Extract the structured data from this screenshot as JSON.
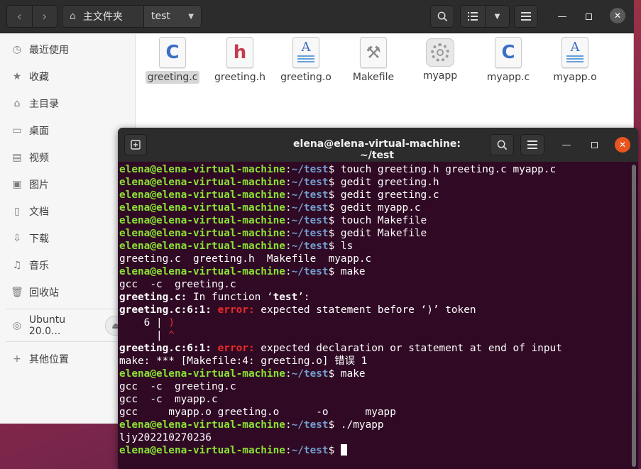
{
  "file_manager": {
    "path": {
      "home_label": "主文件夹",
      "current": "test"
    },
    "sidebar": {
      "items": [
        {
          "icon": "clock-icon",
          "label": "最近使用"
        },
        {
          "icon": "star-icon",
          "label": "收藏"
        },
        {
          "icon": "home-icon",
          "label": "主目录"
        },
        {
          "icon": "desktop-icon",
          "label": "桌面"
        },
        {
          "icon": "video-icon",
          "label": "视频"
        },
        {
          "icon": "picture-icon",
          "label": "图片"
        },
        {
          "icon": "document-icon",
          "label": "文档"
        },
        {
          "icon": "download-icon",
          "label": "下载"
        },
        {
          "icon": "music-icon",
          "label": "音乐"
        },
        {
          "icon": "trash-icon",
          "label": "回收站"
        }
      ],
      "devices": [
        {
          "icon": "disc-icon",
          "label": "Ubuntu 20.0..."
        }
      ],
      "other": {
        "icon": "plus-icon",
        "label": "其他位置"
      }
    },
    "files": [
      {
        "name": "greeting.c",
        "kind": "c-source",
        "selected": true
      },
      {
        "name": "greeting.h",
        "kind": "c-header",
        "selected": false
      },
      {
        "name": "greeting.o",
        "kind": "text",
        "selected": false
      },
      {
        "name": "Makefile",
        "kind": "makefile",
        "selected": false
      },
      {
        "name": "myapp",
        "kind": "executable",
        "selected": false
      },
      {
        "name": "myapp.c",
        "kind": "c-source",
        "selected": false
      },
      {
        "name": "myapp.o",
        "kind": "text",
        "selected": false
      }
    ]
  },
  "terminal": {
    "title": "elena@elena-virtual-machine: ~/test",
    "prompt": {
      "user": "elena@elena-virtual-machine",
      "sep": ":",
      "path": "~/test",
      "dollar": "$ "
    },
    "lines": [
      {
        "type": "prompt",
        "cmd": "touch greeting.h greeting.c myapp.c"
      },
      {
        "type": "prompt",
        "cmd": "gedit greeting.h"
      },
      {
        "type": "prompt",
        "cmd": "gedit greeting.c"
      },
      {
        "type": "prompt",
        "cmd": "gedit myapp.c"
      },
      {
        "type": "prompt",
        "cmd": "touch Makefile"
      },
      {
        "type": "prompt",
        "cmd": "gedit Makefile"
      },
      {
        "type": "prompt",
        "cmd": "ls"
      },
      {
        "type": "out",
        "text": "greeting.c  greeting.h  Makefile  myapp.c"
      },
      {
        "type": "prompt",
        "cmd": "make"
      },
      {
        "type": "out",
        "text": "gcc  -c  greeting.c"
      },
      {
        "type": "infn",
        "file": "greeting.c:",
        "text": " In function ‘",
        "fn": "test",
        "end": "’:"
      },
      {
        "type": "error",
        "loc": "greeting.c:6:1:",
        "label": " error:",
        "msg": " expected statement before ‘)’ token"
      },
      {
        "type": "code",
        "gutter": "    6 | ",
        "code": ")"
      },
      {
        "type": "code",
        "gutter": "      | ",
        "code": "^"
      },
      {
        "type": "error",
        "loc": "greeting.c:6:1:",
        "label": " error:",
        "msg": " expected declaration or statement at end of input"
      },
      {
        "type": "out",
        "text": "make: *** [Makefile:4: greeting.o] 错误 1"
      },
      {
        "type": "prompt",
        "cmd": "make"
      },
      {
        "type": "out",
        "text": "gcc  -c  greeting.c"
      },
      {
        "type": "out",
        "text": "gcc  -c  myapp.c"
      },
      {
        "type": "out",
        "text": "gcc     myapp.o greeting.o      -o      myapp"
      },
      {
        "type": "prompt",
        "cmd": "./myapp"
      },
      {
        "type": "out",
        "text": "ljy202210270236"
      },
      {
        "type": "prompt",
        "cmd": "",
        "cursor": true
      }
    ]
  },
  "colors": {
    "terminal_bg": "#300a24",
    "prompt_user": "#8ae234",
    "prompt_path": "#729fcf",
    "error": "#ef2929",
    "close_button": "#e95420"
  }
}
